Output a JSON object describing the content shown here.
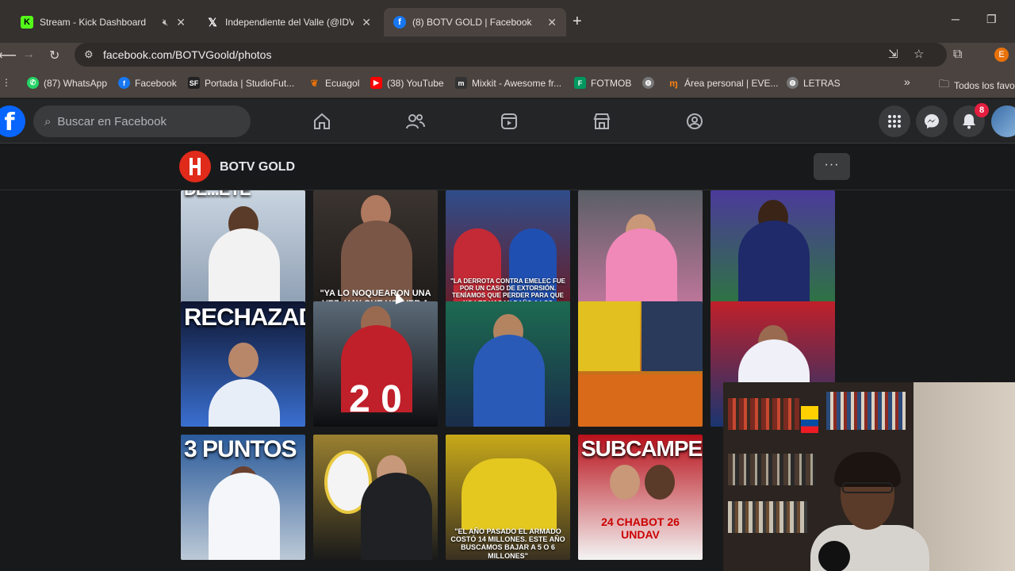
{
  "browser": {
    "tabs": [
      {
        "title": "Stream - Kick Dashboard",
        "icon": "kick-icon",
        "active": false,
        "muted": true
      },
      {
        "title": "Independiente del Valle (@IDV_",
        "icon": "x-icon",
        "active": false
      },
      {
        "title": "(8) BOTV GOLD | Facebook",
        "icon": "facebook-icon",
        "active": true
      }
    ],
    "url": "facebook.com/BOTVGoold/photos",
    "profile_initial": "E",
    "bookmarks": [
      {
        "label": "(87) WhatsApp",
        "icon": "whatsapp-icon",
        "color": "#25d366"
      },
      {
        "label": "Facebook",
        "icon": "facebook-icon",
        "color": "#1877f2"
      },
      {
        "label": "Portada | StudioFut...",
        "icon": "studiofutbol-icon",
        "color": "#222222"
      },
      {
        "label": "Ecuagol",
        "icon": "ecuagol-icon",
        "color": "#e8710a"
      },
      {
        "label": "(38) YouTube",
        "icon": "youtube-icon",
        "color": "#ff0000"
      },
      {
        "label": "Mixkit - Awesome fr...",
        "icon": "mixkit-icon",
        "color": "#333333"
      },
      {
        "label": "FOTMOB",
        "icon": "fotmob-icon",
        "color": "#00985f"
      },
      {
        "label": "",
        "icon": "globe-icon",
        "color": "#888888"
      },
      {
        "label": "Área personal | EVE...",
        "icon": "moodle-icon",
        "color": "#f98012"
      },
      {
        "label": "LETRAS",
        "icon": "globe-icon",
        "color": "#888888"
      }
    ],
    "bookmarks_overflow": "»",
    "all_bookmarks_label": "Todos los favo"
  },
  "facebook": {
    "logo": "f",
    "search_placeholder": "Buscar en Facebook",
    "notification_count": "8",
    "accent": "#0866ff"
  },
  "page": {
    "name": "BOTV GOLD",
    "more_label": "···"
  },
  "photos": [
    {
      "big": "DE...ETE",
      "caption": "",
      "bg": "linear-gradient(#c9d4e0,#8a9bb0)"
    },
    {
      "big": "",
      "caption": "\"YA LO NOQUEARON UNA VEZ, HAY QUE VOLVER A NOQUEARLO\"",
      "bg": "linear-gradient(#3b3430,#1c1917)"
    },
    {
      "big": "",
      "caption": "\"LA DERROTA CONTRA EMELEC FUE POR UN CASO DE EXTORSIÓN. TENÍAMOS QUE PERDER PARA QUE NO LES HAGAN DAÑO A LOS FAMILIARES DE LOS JUGADORES\"",
      "bg": "linear-gradient(#2f4d8a,#6b1a22)"
    },
    {
      "big": "",
      "caption": "",
      "bg": "linear-gradient(#5a5f66,#c8789f)"
    },
    {
      "big": "",
      "caption": "",
      "bg": "linear-gradient(#4b3a9a,#2b7a3a)"
    },
    {
      "big": "RECHAZADO",
      "caption": "",
      "bg": "linear-gradient(#0e1530,#3a6fd0)"
    },
    {
      "big": "",
      "caption": "",
      "score": "2 0",
      "bg": "linear-gradient(#5b6a78,#0e0e10)"
    },
    {
      "big": "",
      "caption": "",
      "bg": "linear-gradient(#1c6a50,#1a2c4a)"
    },
    {
      "big": "",
      "caption": "",
      "bg": "linear-gradient(#d9a919,#b44a1a)"
    },
    {
      "big": "",
      "caption": "",
      "bg": "linear-gradient(#c0202a,#1a3570)"
    },
    {
      "big": "3 PUNTOS",
      "caption": "",
      "bg": "linear-gradient(#2a5a9a,#bcc9d6)"
    },
    {
      "big": "",
      "caption": "",
      "bg": "linear-gradient(#9a8030,#1a1a1a)"
    },
    {
      "big": "",
      "caption": "\"EL AÑO PASADO EL ARMADO COSTÓ 14 MILLONES. ESTE AÑO BUSCAMOS BAJAR A 5 O 6 MILLONES\"",
      "bg": "linear-gradient(#c8a91a,#3a3020)"
    },
    {
      "big": "SUBCAMPEÓN",
      "caption": "24 CHABOT 26 UNDAV",
      "bg": "linear-gradient(#b8101a,#f4f4f4)"
    }
  ]
}
